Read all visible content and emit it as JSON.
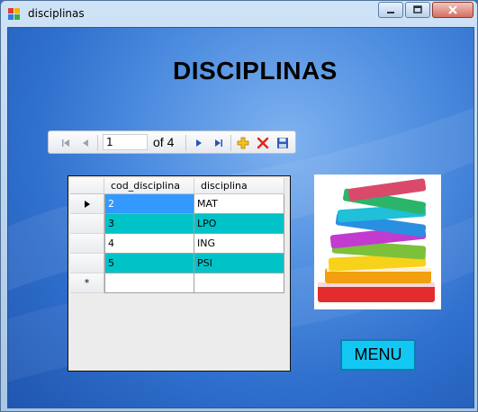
{
  "window": {
    "title": "disciplinas",
    "controls": [
      "minimize-icon",
      "maximize-icon",
      "close-icon"
    ]
  },
  "heading": "DISCIPLINAS",
  "navigator": {
    "position": "1",
    "of_label": "of 4",
    "buttons": [
      "move-first-icon",
      "move-previous-icon",
      "move-next-icon",
      "move-last-icon",
      "add-new-icon",
      "delete-icon",
      "save-icon"
    ]
  },
  "grid": {
    "columns": [
      "cod_disciplina",
      "disciplina"
    ],
    "rows": [
      {
        "cod": "2",
        "disciplina": "MAT",
        "style": "selected"
      },
      {
        "cod": "3",
        "disciplina": "LPO",
        "style": "alternate"
      },
      {
        "cod": "4",
        "disciplina": "ING",
        "style": "normal"
      },
      {
        "cod": "5",
        "disciplina": "PSI",
        "style": "alternate"
      },
      {
        "cod": "",
        "disciplina": "",
        "style": "new"
      }
    ],
    "new_row_marker": "*",
    "colors": {
      "selected": "#3399ff",
      "alternate": "#00c3c8",
      "normal": "#ffffff"
    }
  },
  "menu_button": "MENU",
  "colors": {
    "menu_button": "#12c8f3",
    "desktop": "#2f6fcd"
  }
}
